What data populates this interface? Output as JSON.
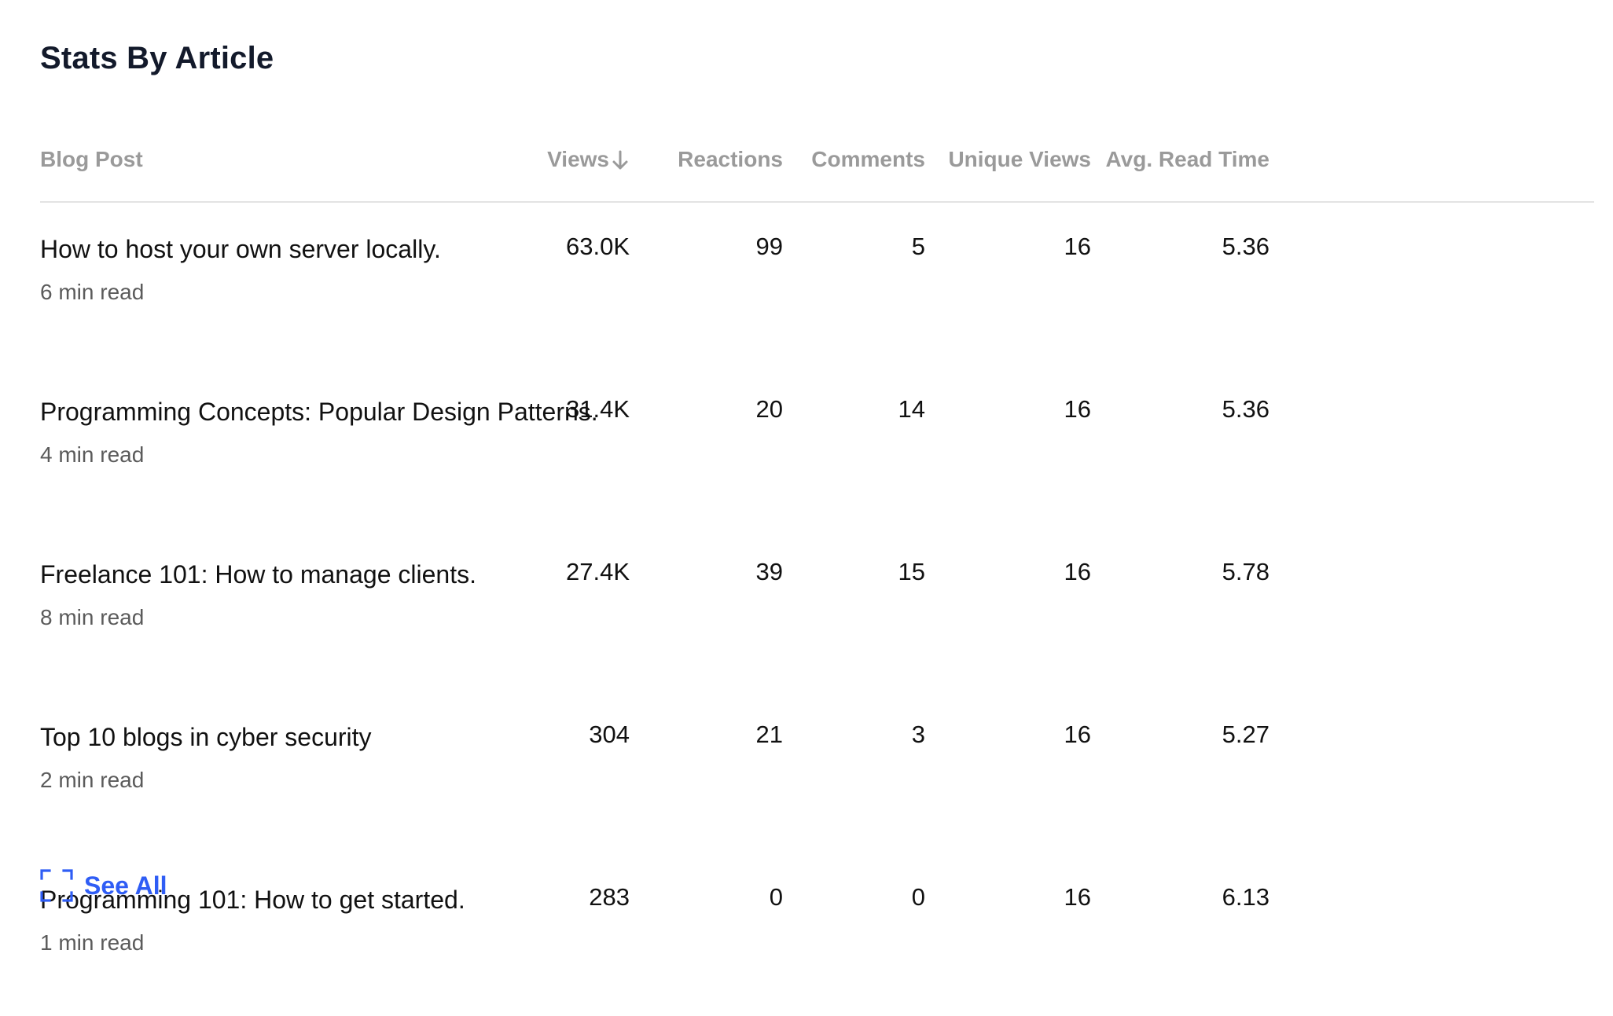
{
  "page": {
    "title": "Stats By Article"
  },
  "table": {
    "columns": [
      {
        "label": "Blog Post"
      },
      {
        "label": "Views",
        "sorted": "descending"
      },
      {
        "label": "Reactions"
      },
      {
        "label": "Comments"
      },
      {
        "label": "Unique Views"
      },
      {
        "label": "Avg. Read Time"
      }
    ],
    "rows": [
      {
        "title": "How to host your own server locally.",
        "read_time": "6 min read",
        "views": "63.0K",
        "reactions": "99",
        "comments": "5",
        "unique_views": "16",
        "avg_read_time": "5.36"
      },
      {
        "title": "Programming Concepts: Popular Design Patterns.",
        "read_time": "4 min read",
        "views": "31.4K",
        "reactions": "20",
        "comments": "14",
        "unique_views": "16",
        "avg_read_time": "5.36"
      },
      {
        "title": "Freelance 101: How to manage clients.",
        "read_time": "8 min read",
        "views": "27.4K",
        "reactions": "39",
        "comments": "15",
        "unique_views": "16",
        "avg_read_time": "5.78"
      },
      {
        "title": "Top 10 blogs in cyber security",
        "read_time": "2 min read",
        "views": "304",
        "reactions": "21",
        "comments": "3",
        "unique_views": "16",
        "avg_read_time": "5.27"
      },
      {
        "title": "Programming 101: How to get started.",
        "read_time": "1 min read",
        "views": "283",
        "reactions": "0",
        "comments": "0",
        "unique_views": "16",
        "avg_read_time": "6.13"
      }
    ]
  },
  "footer": {
    "see_all_label": "See All",
    "see_all_icon": "expand-corners-icon"
  },
  "colors": {
    "link": "#2f5df5",
    "header_text": "#9a9a9a",
    "title_text": "#131a2b",
    "muted_text": "#5b5b5b",
    "divider": "#e3e3e3"
  }
}
